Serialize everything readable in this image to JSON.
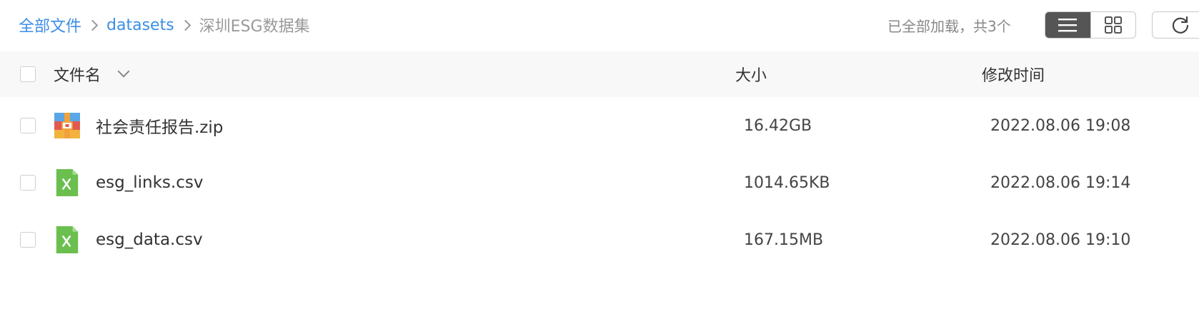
{
  "breadcrumb": {
    "root": "全部文件",
    "folder": "datasets",
    "current": "深圳ESG数据集"
  },
  "status": {
    "loaded_text": "已全部加载，共3个"
  },
  "toolbar": {
    "view_modes": [
      "list-icon",
      "grid-icon"
    ],
    "active_view": "list-icon",
    "refresh_icon": "refresh-icon"
  },
  "table": {
    "columns": {
      "name": "文件名",
      "size": "大小",
      "modified": "修改时间"
    },
    "rows": [
      {
        "name": "社会责任报告.zip",
        "size": "16.42GB",
        "modified": "2022.08.06 19:08",
        "icon": "zip-file-icon"
      },
      {
        "name": "esg_links.csv",
        "size": "1014.65KB",
        "modified": "2022.08.06 19:14",
        "icon": "excel-file-icon"
      },
      {
        "name": "esg_data.csv",
        "size": "167.15MB",
        "modified": "2022.08.06 19:10",
        "icon": "excel-file-icon"
      }
    ]
  },
  "colors": {
    "accent": "#3a8ee6",
    "excel_green": "#6bbf4e",
    "header_bg": "#f8f8f9"
  }
}
